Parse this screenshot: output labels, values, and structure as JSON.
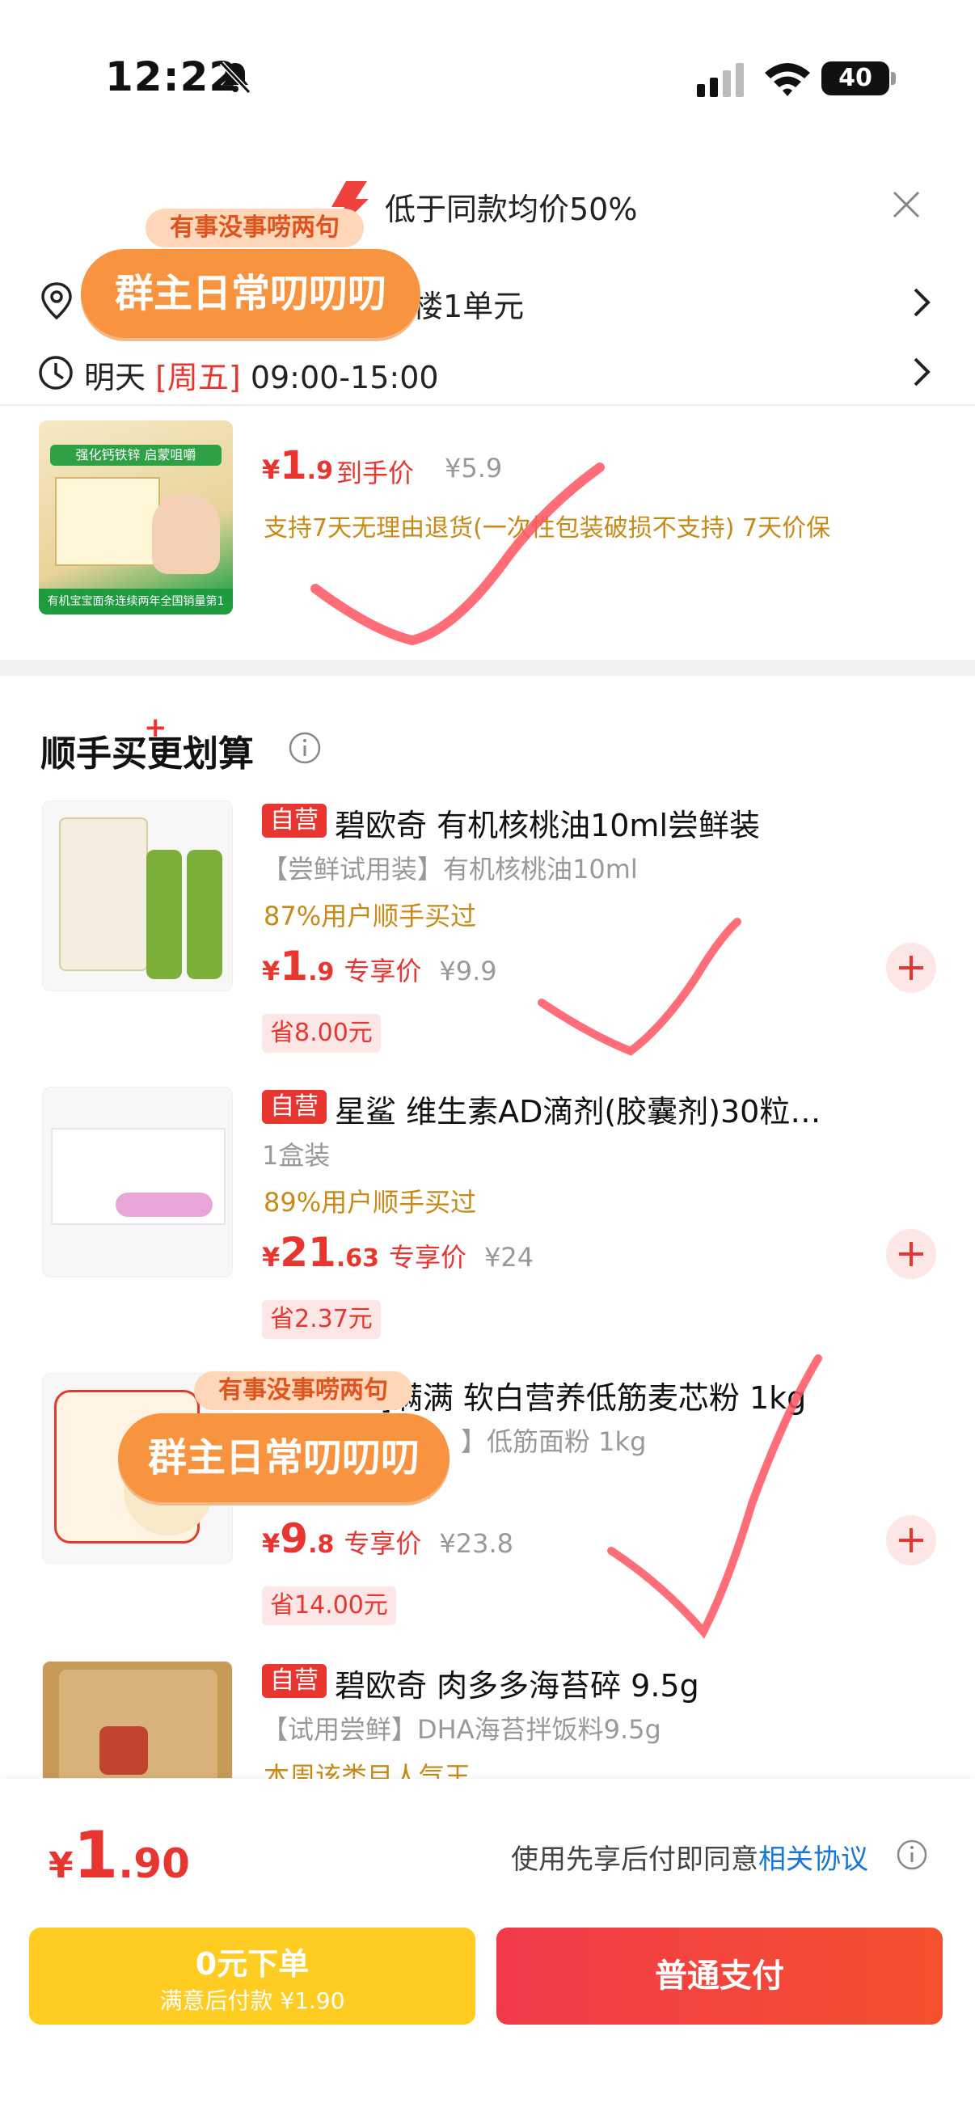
{
  "status_bar": {
    "time": "12:22",
    "battery": "40"
  },
  "banner": {
    "text": "低于同款均价50%"
  },
  "address": {
    "text": "楼1单元"
  },
  "delivery": {
    "prefix": "明天 ",
    "weekday": "[周五]",
    "time": " 09:00-15:00"
  },
  "main_product": {
    "image_banner": "强化钙铁锌 启蒙咀嚼",
    "image_bottom": "有机宝宝面条连续两年全国销量第1",
    "price_yen": "¥",
    "price_int": "1",
    "price_dec": ".9",
    "price_label": "到手价",
    "orig_price": "¥5.9",
    "support": "支持7天无理由退货(一次性包装破损不支持)  7天价保"
  },
  "section": {
    "title": "顺手买更划算",
    "plus": "+"
  },
  "items": [
    {
      "tag": "自营",
      "title": "碧欧奇 有机核桃油10ml尝鲜装",
      "sub": "【尝鲜试用装】有机核桃油10ml",
      "bought": "87%用户顺手买过",
      "yen": "¥",
      "int": "1",
      "dec": ".9",
      "price_label": "专享价",
      "orig": "¥9.9",
      "save": "省8.00元"
    },
    {
      "tag": "自营",
      "title": "星鲨 维生素AD滴剂(胶囊剂)30粒…",
      "sub": "1盒装",
      "bought": "89%用户顺手买过",
      "yen": "¥",
      "int": "21",
      "dec": ".63",
      "price_label": "专享价",
      "orig": "¥24",
      "save": "省2.37元"
    },
    {
      "tag": "",
      "title": "]满满 软白营养低筋麦芯粉 1kg",
      "sub": "】低筋面粉 1kg",
      "bought": "买过",
      "yen": "¥",
      "int": "9",
      "dec": ".8",
      "price_label": "专享价",
      "orig": "¥23.8",
      "save": "省14.00元"
    },
    {
      "tag": "自营",
      "title": "碧欧奇 肉多多海苔碎 9.5g",
      "sub": "【试用尝鲜】DHA海苔拌饭料9.5g",
      "bought": "本周该类目人气王",
      "yen": "",
      "int": "",
      "dec": "",
      "price_label": "",
      "orig": "",
      "save": ""
    }
  ],
  "sticker": {
    "top": "有事没事唠两句",
    "main": "群主日常叨叨叨"
  },
  "bottom": {
    "yen": "¥",
    "int": "1",
    "dec": ".90",
    "agree_prefix": "使用先享后付即同意",
    "agree_link": "相关协议",
    "btn_zero_l1": "0元下单",
    "btn_zero_l2": "满意后付款 ¥1.90",
    "btn_pay": "普通支付"
  },
  "colors": {
    "accent_red": "#e8352f",
    "gold_text": "#c88a16",
    "link_blue": "#1677d6",
    "zero_btn": "#ffcc22"
  }
}
